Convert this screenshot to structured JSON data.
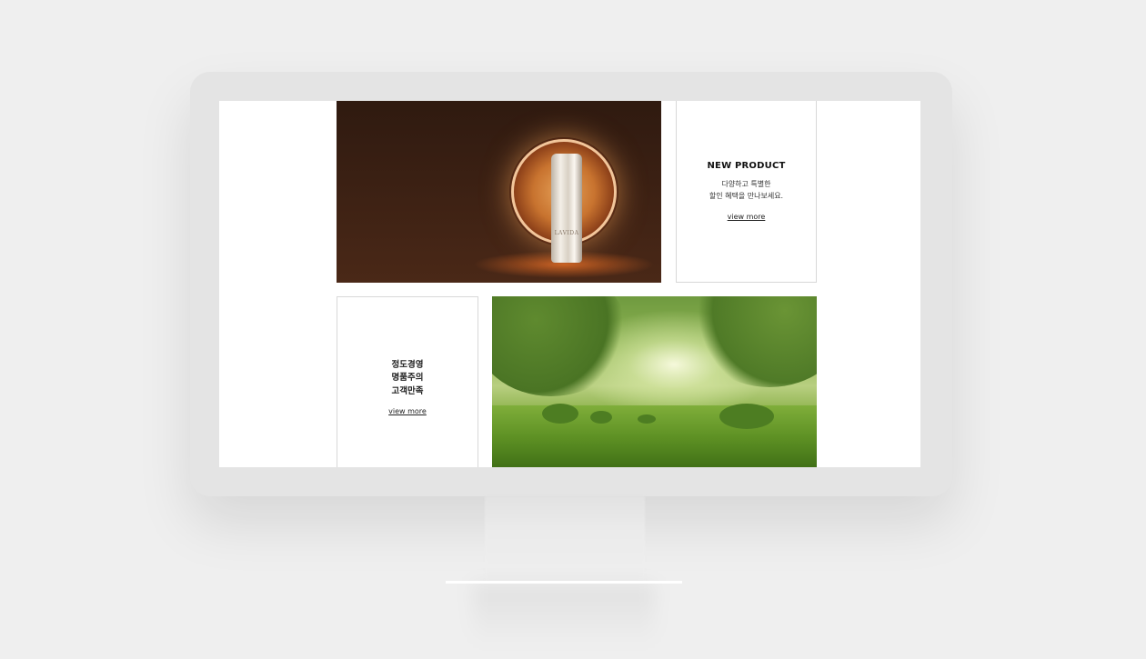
{
  "new_product_card": {
    "title": "NEW PRODUCT",
    "description_line1": "다양하고 특별한",
    "description_line2": "할인 혜택을 만나보세요.",
    "link": "view more"
  },
  "product_banner": {
    "bottle_brand": "LAVIDA"
  },
  "values_card": {
    "line1": "정도경영",
    "line2": "명품주의",
    "line3": "고객만족",
    "link": "view more"
  },
  "colors": {
    "banner_brown": "#4a2817",
    "card_border": "#d8d8d8",
    "monitor_bezel": "#e4e4e4",
    "page_background": "#efefef"
  }
}
